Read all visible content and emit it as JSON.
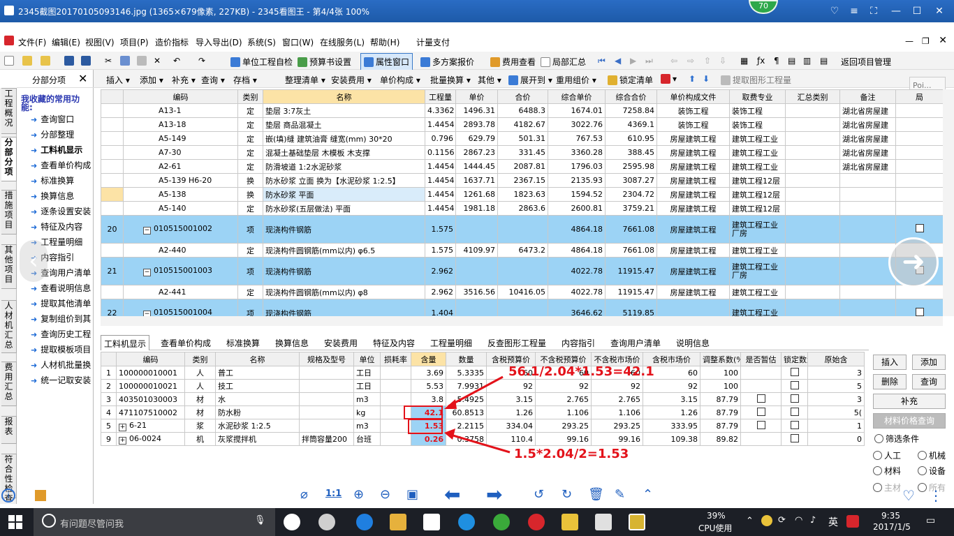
{
  "viewer": {
    "title": "2345截图20170105093146.jpg (1365×679像素, 227KB) - 2345看图王 - 第4/4张 100%",
    "badge": "70"
  },
  "menu": [
    "文件(F)",
    "编辑(E)",
    "视图(V)",
    "项目(P)",
    "造价指标",
    "导入导出(D)",
    "系统(S)",
    "窗口(W)",
    "在线服务(L)",
    "帮助(H)",
    "计量支付"
  ],
  "toolbar1": [
    "单位工程自检",
    "预算书设置",
    "属性窗口",
    "多方案报价",
    "费用查看",
    "局部汇总",
    "返回项目管理"
  ],
  "toolbar2": [
    "插入",
    "添加",
    "补充",
    "查询",
    "存档",
    "整理清单",
    "安装费用",
    "单价构成",
    "批量换算",
    "其他",
    "展开到",
    "重用组价",
    "锁定清单",
    "提取图形工程量"
  ],
  "popup": {
    "title": "Poi...",
    "start": "开始"
  },
  "side_tabs": [
    "工程概况",
    "分部分项",
    "措施项目",
    "其他项目",
    "人材机汇总",
    "费用汇总",
    "报表",
    "符合性检查"
  ],
  "side_panel": {
    "title": "分部分项",
    "fav_title": "我收藏的常用功能:",
    "items": [
      "查询窗口",
      "分部整理",
      "工料机显示",
      "查看单价构成",
      "标准换算",
      "换算信息",
      "逐条设置安装",
      "特征及内容",
      "工程量明细",
      "内容指引",
      "查询用户清单",
      "查看说明信息",
      "提取其他清单",
      "复制组价到其",
      "查询历史工程",
      "提取模板项目",
      "人材机批量换",
      "统一记取安装"
    ]
  },
  "top_grid": {
    "headers": [
      "编码",
      "类别",
      "名称",
      "工程量",
      "单价",
      "合价",
      "综合单价",
      "综合合价",
      "单价构成文件",
      "取费专业",
      "汇总类别",
      "备注",
      "局"
    ],
    "rows": [
      {
        "no": "",
        "code": "A13-1",
        "type": "定",
        "name": "垫层 3:7灰土",
        "qty": "4.3362",
        "price": "1496.31",
        "total": "6488.3",
        "uprice": "1674.01",
        "utotal": "7258.84",
        "file": "装饰工程",
        "spec": "装饰工程",
        "note": "湖北省房屋建"
      },
      {
        "no": "",
        "code": "A13-18",
        "type": "定",
        "name": "垫层 商品混凝土",
        "qty": "1.4454",
        "price": "2893.78",
        "total": "4182.67",
        "uprice": "3022.76",
        "utotal": "4369.1",
        "file": "装饰工程",
        "spec": "装饰工程",
        "note": "湖北省房屋建"
      },
      {
        "no": "",
        "code": "A5-149",
        "type": "定",
        "name": "嵌(填)缝 建筑油膏 缝宽(mm) 30*20",
        "qty": "0.796",
        "price": "629.79",
        "total": "501.31",
        "uprice": "767.53",
        "utotal": "610.95",
        "file": "房屋建筑工程",
        "spec": "建筑工程工业",
        "note": "湖北省房屋建"
      },
      {
        "no": "",
        "code": "A7-30",
        "type": "定",
        "name": "混凝土基础垫层 木模板 木支撑",
        "qty": "0.1156",
        "price": "2867.23",
        "total": "331.45",
        "uprice": "3360.28",
        "utotal": "388.45",
        "file": "房屋建筑工程",
        "spec": "建筑工程工业",
        "note": "湖北省房屋建"
      },
      {
        "no": "",
        "code": "A2-61",
        "type": "定",
        "name": "防滑坡道 1:2水泥砂浆",
        "qty": "1.4454",
        "price": "1444.45",
        "total": "2087.81",
        "uprice": "1796.03",
        "utotal": "2595.98",
        "file": "房屋建筑工程",
        "spec": "建筑工程工业",
        "note": "湖北省房屋建"
      },
      {
        "no": "",
        "code": "A5-139 H6-20",
        "type": "换",
        "name": "防水砂浆 立面 换为【水泥砂浆 1:2.5】",
        "qty": "1.4454",
        "price": "1637.71",
        "total": "2367.15",
        "uprice": "2135.93",
        "utotal": "3087.27",
        "file": "房屋建筑工程",
        "spec": "建筑工程12层",
        "note": ""
      },
      {
        "no": "",
        "code": "A5-138",
        "type": "换",
        "name": "防水砂浆 平面",
        "qty": "1.4454",
        "price": "1261.68",
        "total": "1823.63",
        "uprice": "1594.52",
        "utotal": "2304.72",
        "file": "房屋建筑工程",
        "spec": "建筑工程12层",
        "note": ""
      },
      {
        "no": "",
        "code": "A5-140",
        "type": "定",
        "name": "防水砂浆(五层做法) 平面",
        "qty": "1.4454",
        "price": "1981.18",
        "total": "2863.6",
        "uprice": "2600.81",
        "utotal": "3759.21",
        "file": "房屋建筑工程",
        "spec": "建筑工程12层",
        "note": ""
      },
      {
        "no": "20",
        "code": "010515001002",
        "type": "项",
        "name": "现浇构件钢筋",
        "qty": "1.575",
        "price": "",
        "total": "",
        "uprice": "4864.18",
        "utotal": "7661.08",
        "file": "房屋建筑工程",
        "spec": "建筑工程工业厂房",
        "note": ""
      },
      {
        "no": "",
        "code": "A2-440",
        "type": "定",
        "name": "现浇构件圆钢筋(mm以内) φ6.5",
        "qty": "1.575",
        "price": "4109.97",
        "total": "6473.2",
        "uprice": "4864.18",
        "utotal": "7661.08",
        "file": "房屋建筑工程",
        "spec": "建筑工程工业",
        "note": ""
      },
      {
        "no": "21",
        "code": "010515001003",
        "type": "项",
        "name": "现浇构件钢筋",
        "qty": "2.962",
        "price": "",
        "total": "",
        "uprice": "4022.78",
        "utotal": "11915.47",
        "file": "房屋建筑工程",
        "spec": "建筑工程工业厂房",
        "note": ""
      },
      {
        "no": "",
        "code": "A2-441",
        "type": "定",
        "name": "现浇构件圆钢筋(mm以内) φ8",
        "qty": "2.962",
        "price": "3516.56",
        "total": "10416.05",
        "uprice": "4022.78",
        "utotal": "11915.47",
        "file": "房屋建筑工程",
        "spec": "建筑工程工业",
        "note": ""
      },
      {
        "no": "22",
        "code": "010515001004",
        "type": "项",
        "name": "现浇构件钢筋",
        "qty": "1.404",
        "price": "",
        "total": "",
        "uprice": "3646.62",
        "utotal": "5119.85",
        "file": "",
        "spec": "建筑工程工业",
        "note": ""
      }
    ]
  },
  "bottom_tabs": [
    "工料机显示",
    "查看单价构成",
    "标准换算",
    "换算信息",
    "安装费用",
    "特征及内容",
    "工程量明细",
    "反查图形工程量",
    "内容指引",
    "查询用户清单",
    "说明信息"
  ],
  "bottom_grid": {
    "headers": [
      "编码",
      "类别",
      "名称",
      "规格及型号",
      "单位",
      "损耗率",
      "含量",
      "数量",
      "含税预算价",
      "不含税预算价",
      "不含税市场价",
      "含税市场价",
      "调整系数(%)",
      "是否暂估",
      "锁定数量",
      "原始含"
    ],
    "rows": [
      {
        "no": "1",
        "code": "10000001000​1",
        "type": "人",
        "name": "普工",
        "model": "",
        "unit": "工日",
        "loss": "",
        "content": "3.69",
        "amount": "5.3335",
        "tax_budget": "60",
        "notax_budget": "60",
        "notax_market": "60",
        "tax_market": "60",
        "coef": "100",
        "orig": "3"
      },
      {
        "no": "2",
        "code": "100000010021",
        "type": "人",
        "name": "技工",
        "model": "",
        "unit": "工日",
        "loss": "",
        "content": "5.53",
        "amount": "7.9931",
        "tax_budget": "92",
        "notax_budget": "92",
        "notax_market": "92",
        "tax_market": "92",
        "coef": "100",
        "orig": "5"
      },
      {
        "no": "3",
        "code": "403501030003",
        "type": "材",
        "name": "水",
        "model": "",
        "unit": "m3",
        "loss": "",
        "content": "3.8",
        "amount": "5.4925",
        "tax_budget": "3.15",
        "notax_budget": "2.765",
        "notax_market": "2.765",
        "tax_market": "3.15",
        "coef": "87.79",
        "orig": "3"
      },
      {
        "no": "4",
        "code": "471107510002",
        "type": "材",
        "name": "防水粉",
        "model": "",
        "unit": "kg",
        "loss": "",
        "content": "42.1",
        "amount": "60.8513",
        "tax_budget": "1.26",
        "notax_budget": "1.106",
        "notax_market": "1.106",
        "tax_market": "1.26",
        "coef": "87.79",
        "orig": "5("
      },
      {
        "no": "5",
        "code": "6-21",
        "type": "浆",
        "name": "水泥砂浆 1:2.5",
        "model": "",
        "unit": "m3",
        "loss": "",
        "content": "1.53",
        "amount": "2.2115",
        "tax_budget": "334.04",
        "notax_budget": "293.25",
        "notax_market": "293.25",
        "tax_market": "333.95",
        "coef": "87.79",
        "orig": "1"
      },
      {
        "no": "9",
        "code": "06-0024",
        "type": "机",
        "name": "灰浆搅拌机",
        "model": "拌筒容量200",
        "unit": "台班",
        "loss": "",
        "content": "0.26",
        "amount": "0.3758",
        "tax_budget": "110.4",
        "notax_budget": "99.16",
        "notax_market": "99.16",
        "tax_market": "109.38",
        "coef": "89.82",
        "orig": "0"
      }
    ]
  },
  "right_buttons": {
    "insert": "插入",
    "add": "添加",
    "delete": "删除",
    "query": "查询",
    "supplement": "补充",
    "price_query": "材料价格查询",
    "filter": "筛选条件",
    "labor": "人工",
    "machine": "机械",
    "material": "材料",
    "equipment": "设备",
    "main": "主材",
    "all": "所有"
  },
  "annotations": {
    "top": "56.1/2.04*1.53=42.1",
    "bottom": "1.5*2.04/2=1.53"
  },
  "viewer_tools": {
    "ratio": "1:1"
  },
  "taskbar": {
    "search": "有问题尽管问我",
    "cpu": "39%",
    "cpu_label": "CPU使用",
    "ime": "英",
    "time": "9:35",
    "date": "2017/1/5"
  },
  "colors": {
    "title": "#1d5aa8",
    "highlight": "#9cd3f5",
    "selected": "#fce3a6",
    "annotation": "#e3121a"
  }
}
